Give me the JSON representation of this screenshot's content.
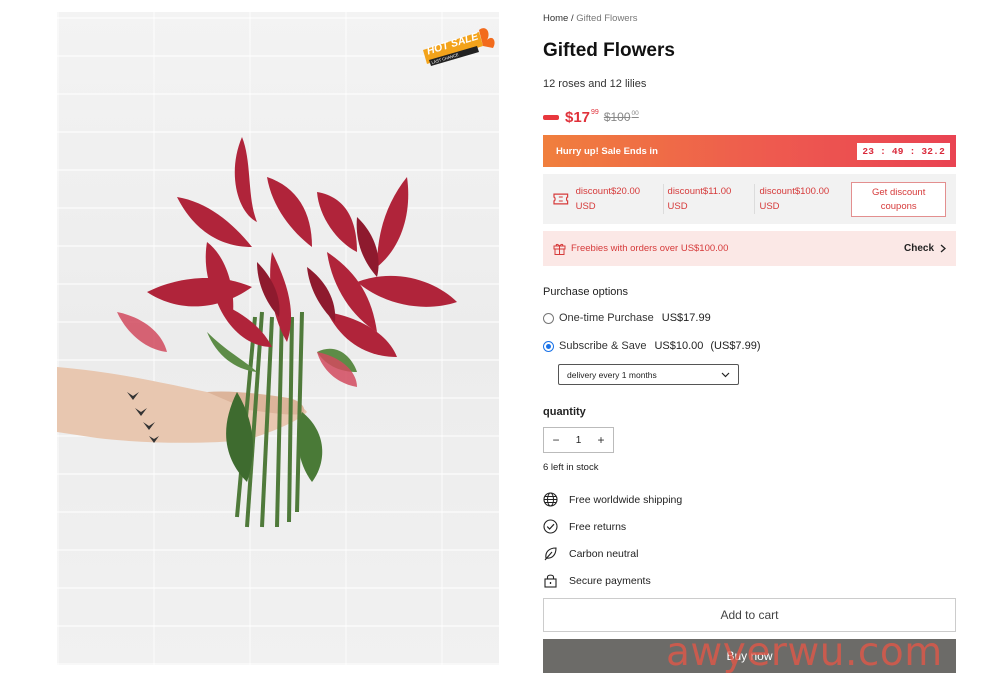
{
  "breadcrumb": {
    "home": "Home",
    "separator": "/",
    "current": "Gifted Flowers"
  },
  "product": {
    "title": "Gifted Flowers",
    "subtitle": "12 roses and 12 lilies",
    "price_main": "$17",
    "price_main_cents": "99",
    "price_old": "$100",
    "price_old_cents": "00",
    "badge_main": "HOT SALE",
    "badge_sub": "LAST CHANCE",
    "image_alt_icon": "flower-bouquet-image"
  },
  "sale_timer": {
    "text": "Hurry up! Sale Ends in",
    "countdown": "23 : 49 : 32.2"
  },
  "coupons": {
    "items": [
      {
        "label": "discount$20.00",
        "unit": "USD"
      },
      {
        "label": "discount$11.00",
        "unit": "USD"
      },
      {
        "label": "discount$100.00",
        "unit": "USD"
      }
    ],
    "button_line1": "Get discount",
    "button_line2": "coupons"
  },
  "freebies": {
    "text_prefix": "Freebies with orders over ",
    "threshold": "US$100.00",
    "check_label": "Check"
  },
  "purchase": {
    "label": "Purchase options",
    "one_time": {
      "label": "One-time Purchase",
      "price": "US$17.99",
      "selected": false
    },
    "subscribe": {
      "label": "Subscribe & Save",
      "price": "US$10.00",
      "original": "(US$7.99)",
      "selected": true
    },
    "delivery_value": "delivery every 1 months"
  },
  "quantity": {
    "label": "quantity",
    "value": "1",
    "minus": "−",
    "plus": "+"
  },
  "stock_text": "6 left in stock",
  "features": [
    {
      "icon": "globe-icon",
      "label": "Free worldwide shipping"
    },
    {
      "icon": "check-circle-icon",
      "label": "Free returns"
    },
    {
      "icon": "leaf-icon",
      "label": "Carbon neutral"
    },
    {
      "icon": "lock-icon",
      "label": "Secure payments"
    }
  ],
  "actions": {
    "add_to_cart": "Add to cart",
    "buy_now": "Buy now"
  },
  "watermark": "awyerwu.com",
  "colors": {
    "accent_red": "#e0323b",
    "timer_gradient_start": "#f07f3d",
    "timer_gradient_end": "#e94352",
    "buy_now_bg": "#6c6b68"
  }
}
